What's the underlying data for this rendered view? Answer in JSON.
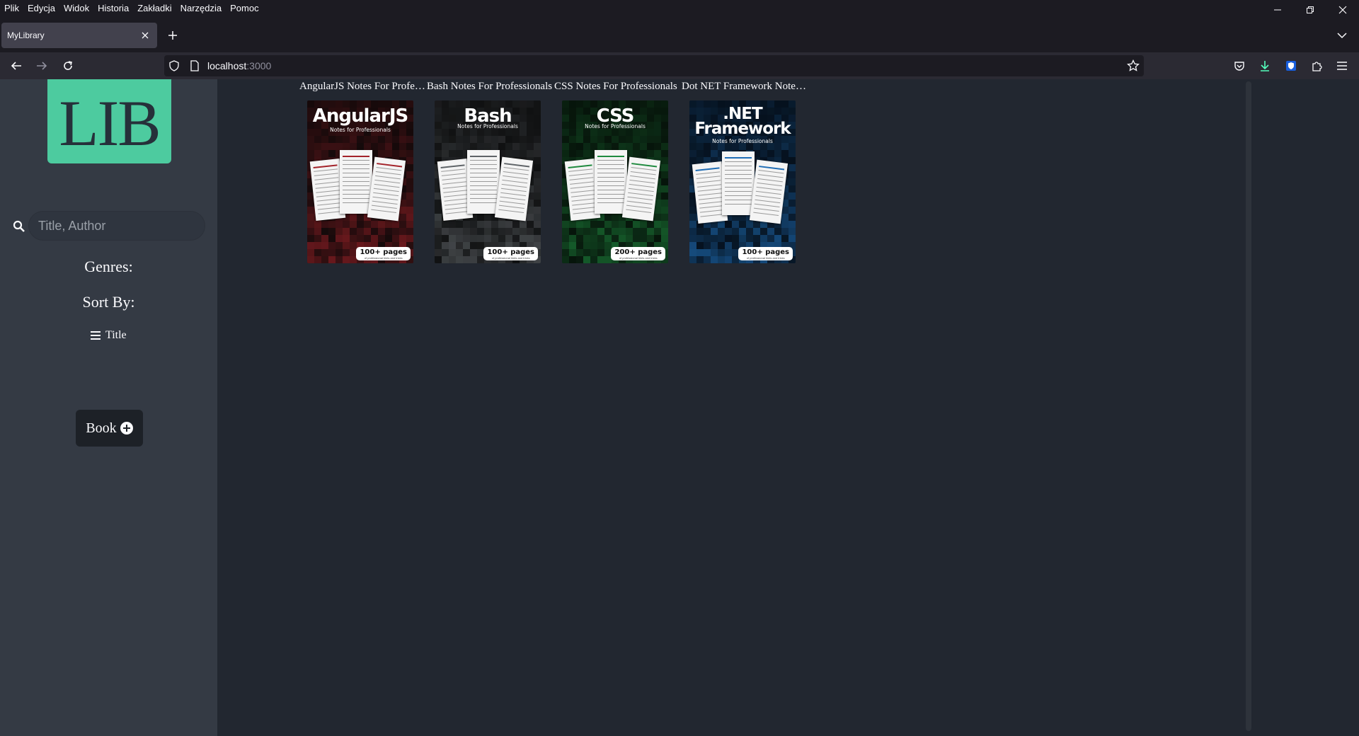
{
  "browser": {
    "menu": [
      "Plik",
      "Edycja",
      "Widok",
      "Historia",
      "Zakładki",
      "Narzędzia",
      "Pomoc"
    ],
    "tab_title": "MyLibrary",
    "url_host": "localhost",
    "url_port": ":3000"
  },
  "sidebar": {
    "logo_text": "LIB",
    "search_placeholder": "Title, Author",
    "genres_label": "Genres:",
    "sort_label": "Sort By:",
    "sort_option": "Title",
    "add_book_label": "Book"
  },
  "books": [
    {
      "title": "AngularJS Notes For Professionals",
      "cover_name": "AngularJS",
      "cover_sub": "Notes for Professionals",
      "pages_badge": "100+ pages",
      "badge_sub": "of professional hints and tricks",
      "accent": "#a3232a",
      "bg": "#150a0b"
    },
    {
      "title": "Bash Notes For Professionals",
      "cover_name": "Bash",
      "cover_sub": "Notes for Professionals",
      "pages_badge": "100+ pages",
      "badge_sub": "of professional hints and tricks",
      "accent": "#5f6468",
      "bg": "#101112"
    },
    {
      "title": "CSS Notes For Professionals",
      "cover_name": "CSS",
      "cover_sub": "Notes for Professionals",
      "pages_badge": "200+ pages",
      "badge_sub": "of professional hints and tricks",
      "accent": "#1f8a3f",
      "bg": "#07140b"
    },
    {
      "title": "Dot NET Framework Notes For Professionals",
      "cover_name": ".NET Framework",
      "cover_sub": "Notes for Professionals",
      "pages_badge": "100+ pages",
      "badge_sub": "of professional hints and tricks",
      "accent": "#1f6db5",
      "bg": "#06111d"
    }
  ]
}
